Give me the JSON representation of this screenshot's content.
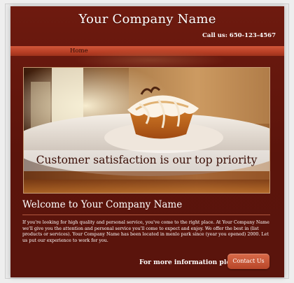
{
  "header": {
    "company_name": "Your Company Name",
    "phone": "Call us: 650-123-4567"
  },
  "nav": {
    "items": [
      {
        "label": "Home"
      }
    ]
  },
  "hero": {
    "tagline": "Customer satisfaction is our top priority",
    "image": "cupcake-on-plate-photo"
  },
  "main": {
    "heading": "Welcome to Your Company Name",
    "body": "If you're looking for high quality and personal service, you've come to the right place. At Your Company Name we'll give you the attention and personal service you'll come to expect and enjoy. We offer the best in (list products or services). Your Company Name has been located in menlo park since (year you opened) 2000. Let us put our experience to work for you."
  },
  "footer_cta": {
    "prompt": "For more information please:",
    "button_label": "Contact Us"
  },
  "colors": {
    "page_bg": "#eeeeee",
    "site_bg": "#5b140b",
    "nav_bar": "#b83f25",
    "button": "#c75535",
    "text": "#ffffff"
  }
}
